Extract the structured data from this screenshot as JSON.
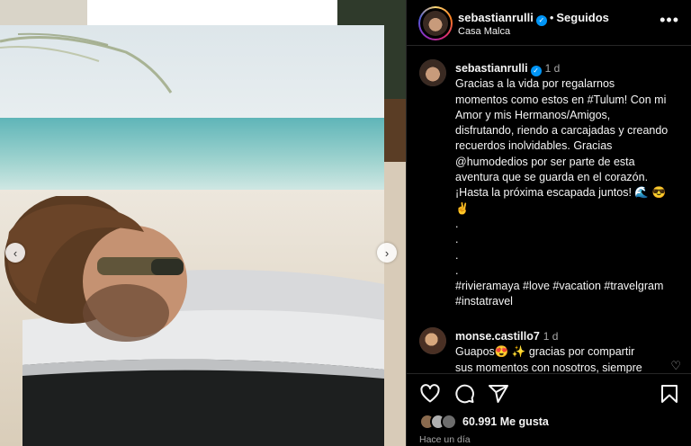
{
  "post": {
    "author": "sebastianrulli",
    "follow_status": "Seguidos",
    "location": "Casa Malca",
    "more_icon": "more-horizontal-icon",
    "caption": {
      "time": "1 d",
      "lines": [
        "Gracias a la vida por regalarnos",
        "momentos como estos en #Tulum! Con mi",
        "Amor y mis Hermanos/Amigos,",
        "disfrutando, riendo a carcajadas y creando",
        "recuerdos inolvidables. Gracias",
        "@humodedios por ser parte de esta",
        "aventura que se guarda en el corazón.",
        "¡Hasta la próxima escapada juntos! 🌊 😎",
        "✌️",
        ".",
        ".",
        ".",
        ".",
        "#rivieramaya #love #vacation #travelgram",
        "#instatravel"
      ]
    },
    "comment": {
      "user": "monse.castillo7",
      "time": "1 d",
      "lines": [
        "Guapos😍 ✨ gracias por compartir",
        "sus momentos con nosotros, siempre"
      ]
    },
    "likes": "60.991 Me gusta",
    "posted": "Hace un día"
  },
  "icons": {
    "like": "heart-icon",
    "comment": "comment-icon",
    "share": "share-icon",
    "save": "bookmark-icon",
    "prev": "chevron-left-icon",
    "next": "chevron-right-icon"
  },
  "colors": {
    "background": "#000000",
    "verified": "#0095f6",
    "muted": "#a8a8a8"
  }
}
